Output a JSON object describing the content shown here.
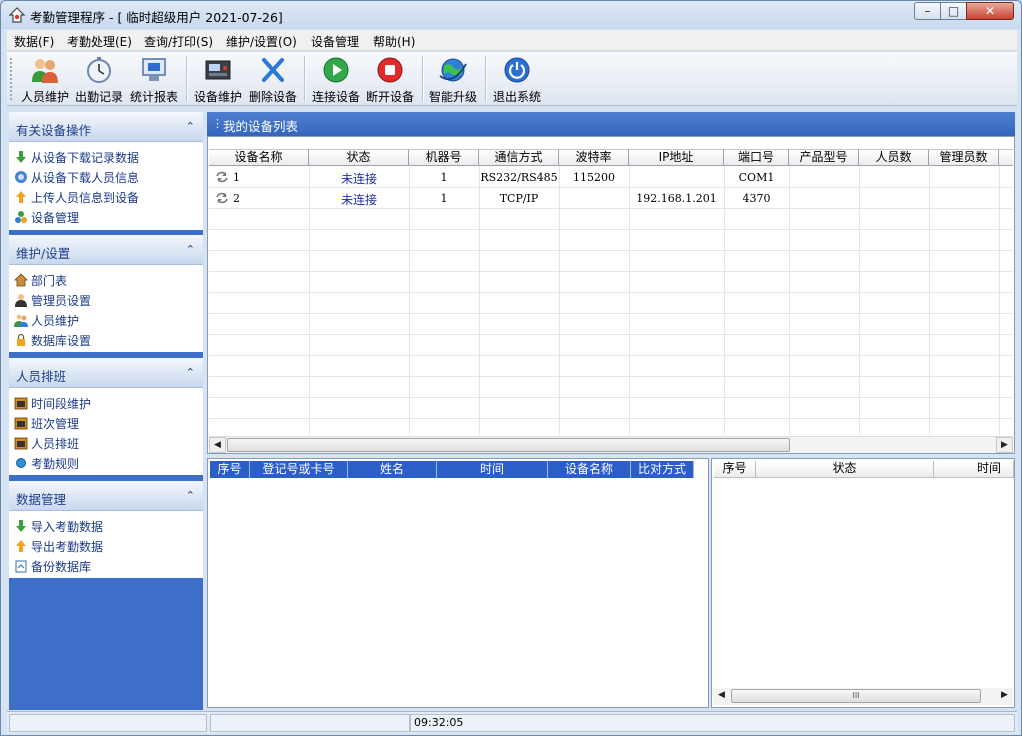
{
  "window": {
    "title": "考勤管理程序 - [ 临时超级用户 2021-07-26]",
    "controls": {
      "minimize": "–",
      "maximize": "□",
      "close": "✕"
    }
  },
  "menu": [
    "数据(F)",
    "考勤处理(E)",
    "查询/打印(S)",
    "维护/设置(O)",
    "设备管理",
    "帮助(H)"
  ],
  "toolbar": [
    {
      "label": "人员维护",
      "icon": "users-icon"
    },
    {
      "label": "出勤记录",
      "icon": "stopwatch-icon"
    },
    {
      "label": "统计报表",
      "icon": "report-icon"
    },
    {
      "label": "设备维护",
      "icon": "device-icon"
    },
    {
      "label": "删除设备",
      "icon": "delete-x-icon"
    },
    {
      "label": "连接设备",
      "icon": "connect-play-icon"
    },
    {
      "label": "断开设备",
      "icon": "disconnect-stop-icon"
    },
    {
      "label": "智能升级",
      "icon": "globe-upgrade-icon"
    },
    {
      "label": "退出系统",
      "icon": "power-icon"
    }
  ],
  "sidebar": {
    "sections": [
      {
        "title": "有关设备操作",
        "items": [
          "从设备下载记录数据",
          "从设备下载人员信息",
          "上传人员信息到设备",
          "设备管理"
        ]
      },
      {
        "title": "维护/设置",
        "items": [
          "部门表",
          "管理员设置",
          "人员维护",
          "数据库设置"
        ]
      },
      {
        "title": "人员排班",
        "items": [
          "时间段维护",
          "班次管理",
          "人员排班",
          "考勤规则"
        ]
      },
      {
        "title": "数据管理",
        "items": [
          "导入考勤数据",
          "导出考勤数据",
          "备份数据库"
        ]
      }
    ]
  },
  "device_list": {
    "title": "我的设备列表",
    "columns": [
      "设备名称",
      "状态",
      "机器号",
      "通信方式",
      "波特率",
      "IP地址",
      "端口号",
      "产品型号",
      "人员数",
      "管理员数"
    ],
    "rows": [
      [
        "1",
        "未连接",
        "1",
        "RS232/RS485",
        "115200",
        "",
        "COM1",
        "",
        "",
        ""
      ],
      [
        "2",
        "未连接",
        "1",
        "TCP/IP",
        "",
        "192.168.1.201",
        "4370",
        "",
        "",
        ""
      ]
    ]
  },
  "records_table": {
    "columns": [
      "序号",
      "登记号或卡号",
      "姓名",
      "时间",
      "设备名称",
      "比对方式"
    ]
  },
  "status_table": {
    "columns": [
      "序号",
      "状态",
      "时间"
    ],
    "thumb_grip": "III"
  },
  "statusbar": {
    "time": "09:32:05"
  }
}
